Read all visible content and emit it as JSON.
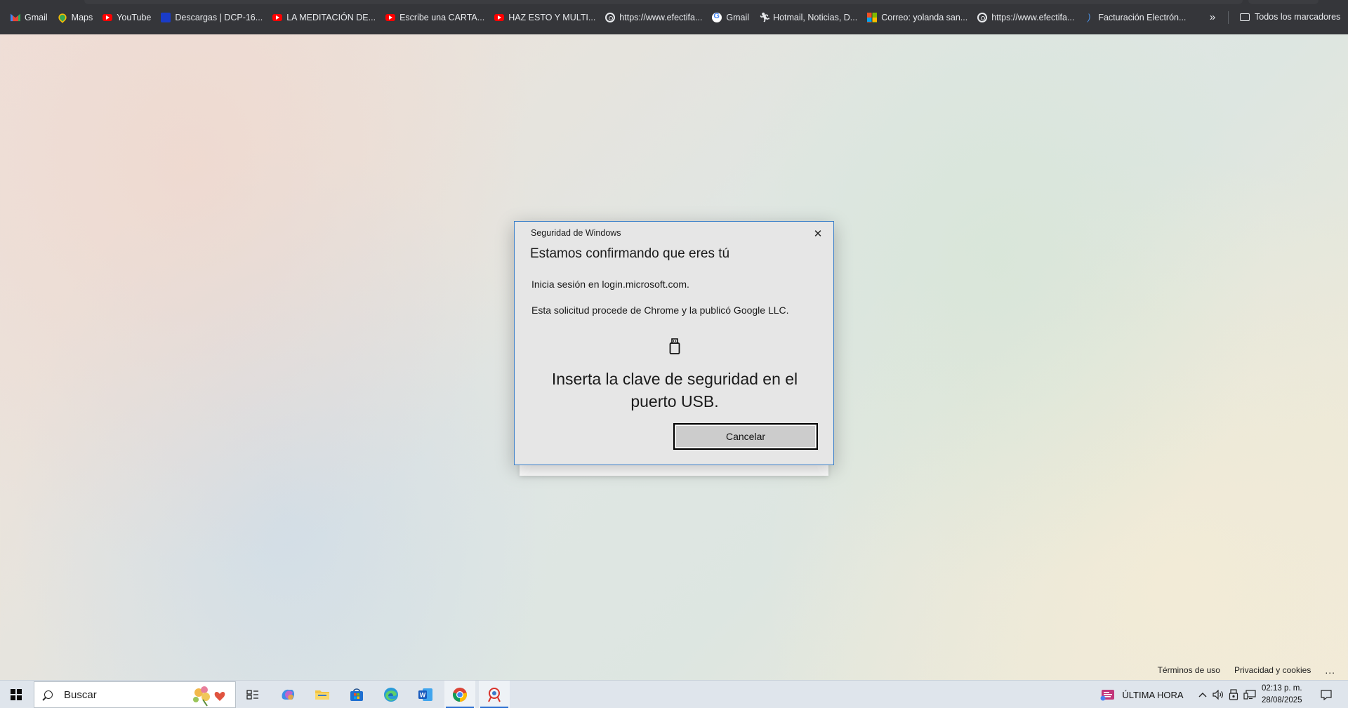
{
  "bookmarks": [
    {
      "label": "Gmail",
      "icon": "gmail-icon"
    },
    {
      "label": "Maps",
      "icon": "maps-icon"
    },
    {
      "label": "YouTube",
      "icon": "youtube-icon"
    },
    {
      "label": "Descargas | DCP-16...",
      "icon": "brother-icon"
    },
    {
      "label": "LA MEDITACIÓN DE...",
      "icon": "youtube-icon"
    },
    {
      "label": "Escribe una CARTA...",
      "icon": "youtube-icon"
    },
    {
      "label": "HAZ ESTO Y MULTI...",
      "icon": "youtube-icon"
    },
    {
      "label": "https://www.efectifa...",
      "icon": "efectifa-icon"
    },
    {
      "label": "Gmail",
      "icon": "google-icon"
    },
    {
      "label": "Hotmail, Noticias, D...",
      "icon": "msn-icon"
    },
    {
      "label": "Correo: yolanda san...",
      "icon": "microsoft-icon"
    },
    {
      "label": "https://www.efectifa...",
      "icon": "efectifa-icon"
    },
    {
      "label": "Facturación Electrón...",
      "icon": "facturacion-icon"
    }
  ],
  "bookmarks_more": "»",
  "all_bookmarks": "Todos los marcadores",
  "dialog": {
    "title": "Seguridad de Windows",
    "close": "✕",
    "heading": "Estamos confirmando que eres tú",
    "line1": "Inicia sesión en login.microsoft.com.",
    "line2": "Esta solicitud procede de Chrome y la publicó Google LLC.",
    "instruction": "Inserta la clave de seguridad en el puerto USB.",
    "cancel": "Cancelar"
  },
  "footer": {
    "terms": "Términos de uso",
    "privacy": "Privacidad y cookies",
    "more": "..."
  },
  "taskbar": {
    "search_placeholder": "Buscar",
    "news": "ÚLTIMA HORA",
    "time": "02:13 p. m.",
    "date": "28/08/2025"
  },
  "colors": {
    "bookmarks_bar": "#35363a",
    "dialog_border": "#3a7fc9",
    "dialog_bg": "#e6e6e6",
    "taskbar_bg": "#dfe5ec",
    "taskbar_active": "#2b6fd1"
  }
}
